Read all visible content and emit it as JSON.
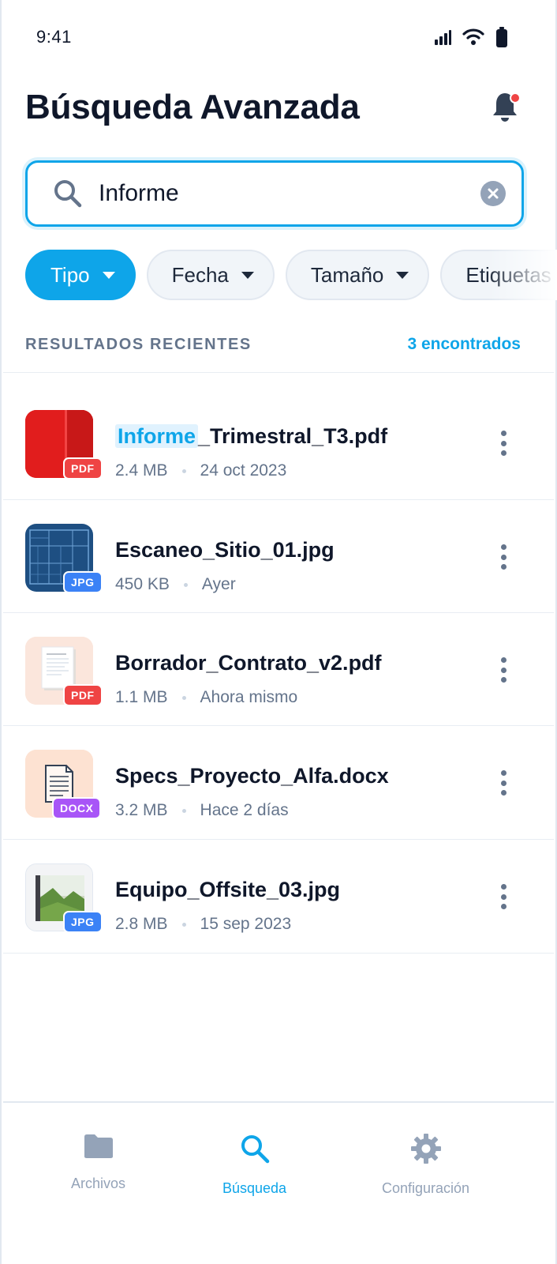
{
  "status_bar": {
    "time": "9:41"
  },
  "header": {
    "title": "Búsqueda Avanzada"
  },
  "search": {
    "value": "Informe"
  },
  "filters": [
    {
      "label": "Tipo",
      "active": true
    },
    {
      "label": "Fecha",
      "active": false
    },
    {
      "label": "Tamaño",
      "active": false
    },
    {
      "label": "Etiquetas",
      "active": false
    }
  ],
  "results": {
    "title": "RESULTADOS RECIENTES",
    "count": "3 encontrados",
    "items": [
      {
        "name_highlight": "Informe",
        "name_rest": "_Trimestral_T3.pdf",
        "size": "2.4 MB",
        "date": "24 oct 2023",
        "badge": "PDF",
        "badge_color": "#ef4444",
        "thumb": "red-document"
      },
      {
        "name_highlight": "",
        "name_rest": "Escaneo_Sitio_01.jpg",
        "size": "450 KB",
        "date": "Ayer",
        "badge": "JPG",
        "badge_color": "#3b82f6",
        "thumb": "blueprint-image"
      },
      {
        "name_highlight": "",
        "name_rest": "Borrador_Contrato_v2.pdf",
        "size": "1.1 MB",
        "date": "Ahora mismo",
        "badge": "PDF",
        "badge_color": "#ef4444",
        "thumb": "contract-page"
      },
      {
        "name_highlight": "",
        "name_rest": "Specs_Proyecto_Alfa.docx",
        "size": "3.2 MB",
        "date": "Hace 2 días",
        "badge": "DOCX",
        "badge_color": "#a855f7",
        "thumb": "text-document"
      },
      {
        "name_highlight": "",
        "name_rest": "Equipo_Offsite_03.jpg",
        "size": "2.8 MB",
        "date": "15 sep 2023",
        "badge": "JPG",
        "badge_color": "#3b82f6",
        "thumb": "landscape-photo"
      }
    ]
  },
  "nav": [
    {
      "label": "Archivos",
      "icon": "folder-icon",
      "active": false
    },
    {
      "label": "Búsqueda",
      "icon": "search-icon",
      "active": true
    },
    {
      "label": "Configuración",
      "icon": "gear-icon",
      "active": false
    }
  ],
  "colors": {
    "accent": "#0ea5e9",
    "text": "#0f172a",
    "muted": "#64748b",
    "notification": "#ef4444"
  }
}
